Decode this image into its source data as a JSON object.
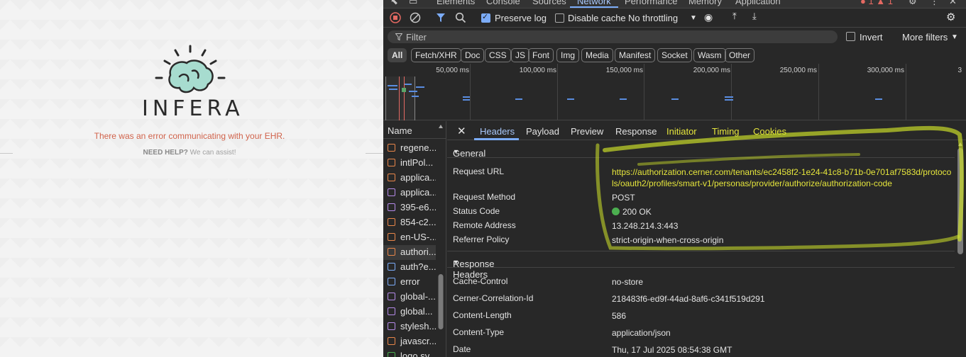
{
  "left_page": {
    "brand": "INFERA",
    "error_message": "There was an error communicating with your EHR.",
    "help_bold": "NEED HELP?",
    "help_text": " We can assist!"
  },
  "devtools": {
    "tabs": [
      "Elements",
      "Console",
      "Sources",
      "Network",
      "Performance",
      "Memory",
      "Application"
    ],
    "active_tab": "Network",
    "toolbar": {
      "preserve_log": "Preserve log",
      "preserve_log_checked": true,
      "disable_cache": "Disable cache",
      "disable_cache_checked": false,
      "throttling": "No throttling"
    },
    "filter": {
      "placeholder": "Filter",
      "invert": "Invert",
      "more_filters": "More filters"
    },
    "type_filters": [
      "All",
      "Fetch/XHR",
      "Doc",
      "CSS",
      "JS",
      "Font",
      "Img",
      "Media",
      "Manifest",
      "Socket",
      "Wasm",
      "Other"
    ],
    "selected_type_filter": "All",
    "timeline_ticks": [
      "50,000 ms",
      "100,000 ms",
      "150,000 ms",
      "200,000 ms",
      "250,000 ms",
      "300,000 ms",
      "3"
    ],
    "name_column_header": "Name",
    "requests": [
      {
        "name": "regene...",
        "icon": "script-icon",
        "color": "#e8864a"
      },
      {
        "name": "intlPol...",
        "icon": "script-icon",
        "color": "#e8864a"
      },
      {
        "name": "applica...",
        "icon": "script-icon",
        "color": "#e8864a"
      },
      {
        "name": "applica...",
        "icon": "stylesheet-icon",
        "color": "#b48ae8"
      },
      {
        "name": "395-e6...",
        "icon": "stylesheet-icon",
        "color": "#b48ae8"
      },
      {
        "name": "854-c2...",
        "icon": "script-icon",
        "color": "#e8864a"
      },
      {
        "name": "en-US-...",
        "icon": "script-icon",
        "color": "#e8864a"
      },
      {
        "name": "authori...",
        "icon": "fetch-icon",
        "color": "#e8864a"
      },
      {
        "name": "auth?e...",
        "icon": "document-icon",
        "color": "#7cacf8"
      },
      {
        "name": "error",
        "icon": "document-icon",
        "color": "#7cacf8"
      },
      {
        "name": "global-...",
        "icon": "stylesheet-icon",
        "color": "#b48ae8"
      },
      {
        "name": "global...",
        "icon": "stylesheet-icon",
        "color": "#b48ae8"
      },
      {
        "name": "stylesh...",
        "icon": "stylesheet-icon",
        "color": "#b48ae8"
      },
      {
        "name": "javascr...",
        "icon": "script-icon",
        "color": "#e8864a"
      },
      {
        "name": "logo.sv...",
        "icon": "image-icon",
        "color": "#4caf50"
      }
    ],
    "selected_request": "authori...",
    "detail_tabs": [
      "Headers",
      "Payload",
      "Preview",
      "Response",
      "Initiator",
      "Timing",
      "Cookies"
    ],
    "active_detail_tab": "Headers",
    "general": {
      "title": "General",
      "rows": [
        {
          "key": "Request URL",
          "value": "https://authorization.cerner.com/tenants/ec2458f2-1e24-41c8-b71b-0e701af7583d/protocols/oauth2/profiles/smart-v1/personas/provider/authorize/authorization-code"
        },
        {
          "key": "Request Method",
          "value": "POST"
        },
        {
          "key": "Status Code",
          "value": "200 OK"
        },
        {
          "key": "Remote Address",
          "value": "13.248.214.3:443"
        },
        {
          "key": "Referrer Policy",
          "value": "strict-origin-when-cross-origin"
        }
      ]
    },
    "response_headers": {
      "title": "Response Headers",
      "rows": [
        {
          "key": "Cache-Control",
          "value": "no-store"
        },
        {
          "key": "Cerner-Correlation-Id",
          "value": "218483f6-ed9f-44ad-8af6-c341f519d291"
        },
        {
          "key": "Content-Length",
          "value": "586"
        },
        {
          "key": "Content-Type",
          "value": "application/json"
        },
        {
          "key": "Date",
          "value": "Thu, 17 Jul 2025 08:54:38 GMT"
        }
      ]
    }
  }
}
